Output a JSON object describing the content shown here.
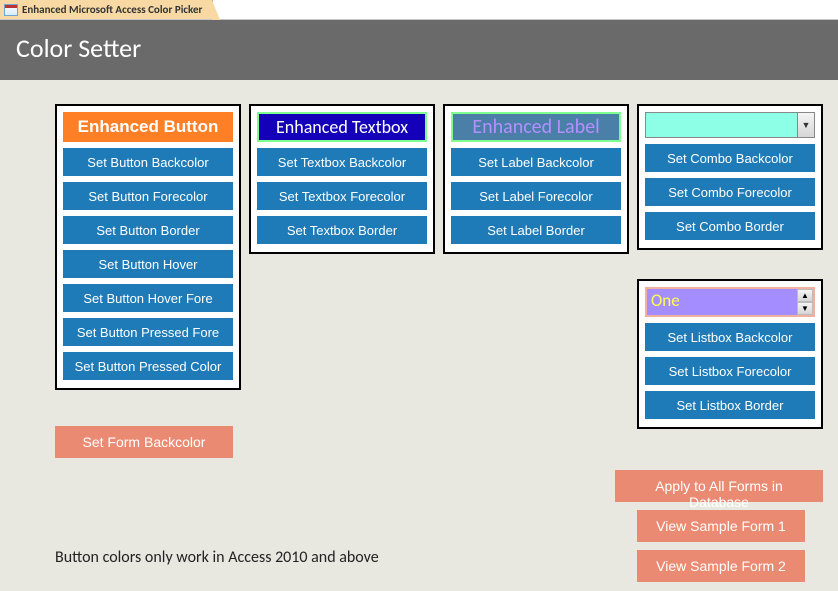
{
  "window": {
    "tab_title": "Enhanced Microsoft Access Color Picker"
  },
  "header": {
    "title": "Color Setter"
  },
  "panels": {
    "button": {
      "demo_label": "Enhanced Button",
      "actions": [
        "Set Button Backcolor",
        "Set Button Forecolor",
        "Set Button Border",
        "Set Button Hover",
        "Set Button Hover Fore",
        "Set Button Pressed Fore",
        "Set Button Pressed Color"
      ]
    },
    "textbox": {
      "demo_label": "Enhanced Textbox",
      "actions": [
        "Set Textbox Backcolor",
        "Set Textbox Forecolor",
        "Set Textbox Border"
      ]
    },
    "label": {
      "demo_label": "Enhanced Label",
      "actions": [
        "Set Label Backcolor",
        "Set Label Forecolor",
        "Set Label Border"
      ]
    },
    "combo": {
      "demo_value": "",
      "actions": [
        "Set Combo Backcolor",
        "Set Combo Forecolor",
        "Set Combo Border"
      ]
    },
    "listbox": {
      "demo_value": "One",
      "actions": [
        "Set Listbox Backcolor",
        "Set Listbox Forecolor",
        "Set Listbox Border"
      ]
    }
  },
  "form_button": {
    "label": "Set Form Backcolor"
  },
  "right_buttons": {
    "apply_all": "Apply to All Forms in Database",
    "view1": "View Sample Form 1",
    "view2": "View Sample Form 2"
  },
  "note": "Button colors only work in Access 2010 and above"
}
